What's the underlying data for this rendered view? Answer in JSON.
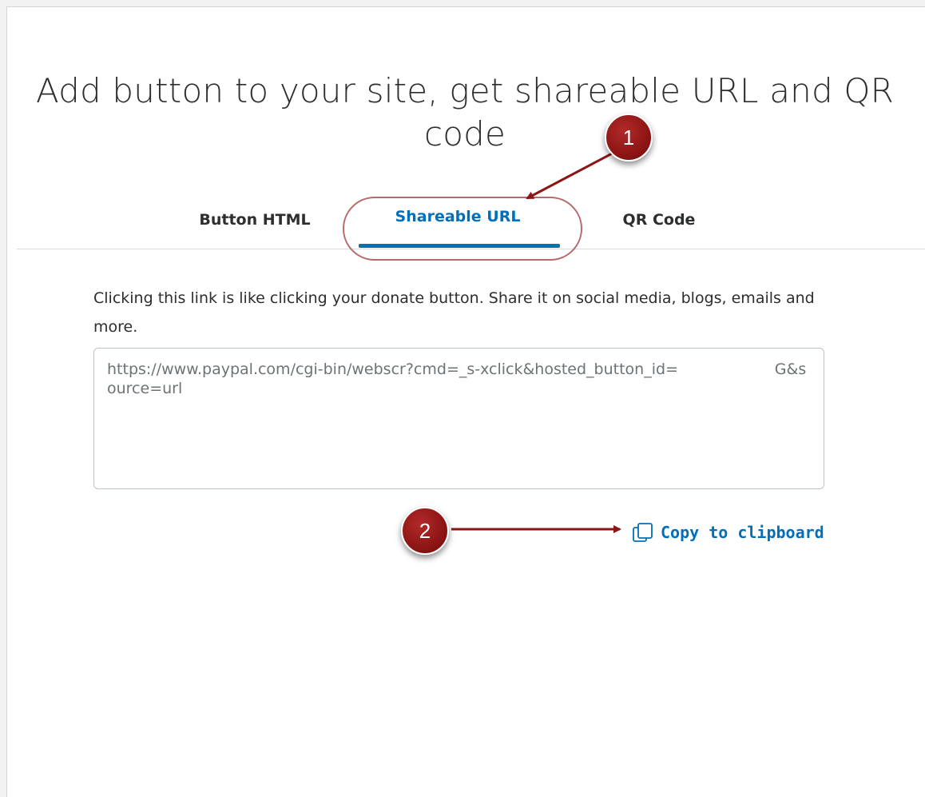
{
  "title": "Add button to your site, get shareable URL and QR code",
  "tabs": [
    {
      "label": "Button HTML",
      "active": false
    },
    {
      "label": "Shareable URL",
      "active": true
    },
    {
      "label": "QR Code",
      "active": false
    }
  ],
  "description": "Clicking this link is like clicking your donate button. Share it on social media, blogs, emails and more.",
  "url_field": {
    "value": "https://www.paypal.com/cgi-bin/webscr?cmd=_s-xclick&hosted_button_id=                    G&source=url"
  },
  "copy_link": {
    "label": "Copy to clipboard",
    "icon": "copy-icon"
  },
  "callouts": [
    {
      "number": "1"
    },
    {
      "number": "2"
    }
  ],
  "colors": {
    "accent": "#0070ba",
    "callout": "#8e1515",
    "text": "#2c2e2f"
  }
}
